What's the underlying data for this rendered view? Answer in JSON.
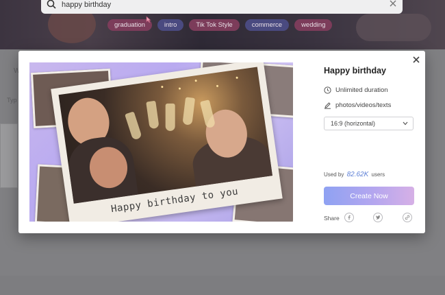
{
  "search": {
    "value": "happy birthday"
  },
  "tags": [
    {
      "label": "graduation"
    },
    {
      "label": "intro"
    },
    {
      "label": "Tik Tok Style"
    },
    {
      "label": "commerce"
    },
    {
      "label": "wedding"
    }
  ],
  "background": {
    "letter_w": "W",
    "letter_typ": "Typ"
  },
  "modal": {
    "title": "Happy birthday",
    "duration": "Unlimited duration",
    "media": "photos/videos/texts",
    "aspect_select": "16:9 (horizontal)",
    "used_prefix": "Used by",
    "used_count": "82.62K",
    "used_suffix": "users",
    "create_label": "Create Now",
    "share_label": "Share",
    "preview_caption": "Happy birthday to you"
  },
  "colors": {
    "accent_blue": "#5c7fd6",
    "button_start": "#8fa2f2",
    "button_end": "#d6b0e6",
    "tag": "#7c3c5a"
  }
}
